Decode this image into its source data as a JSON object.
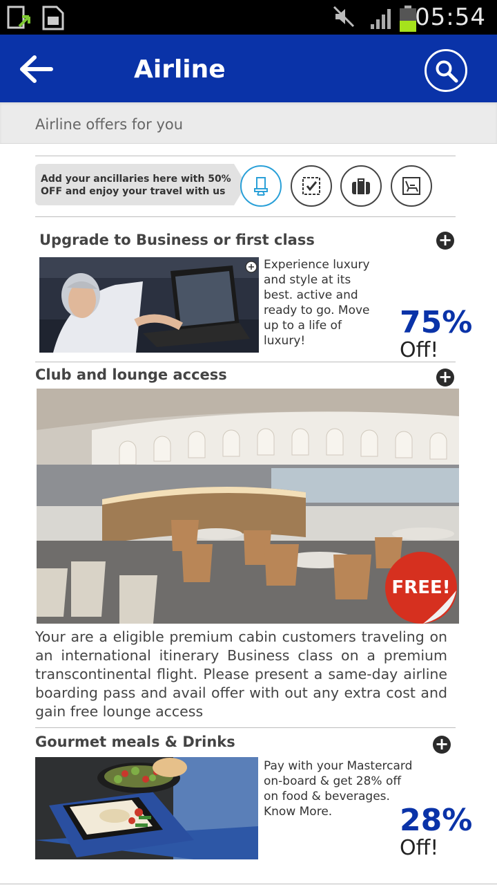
{
  "status_bar": {
    "time": "05:54",
    "icons": [
      "download-icon",
      "sim-card-icon",
      "mute-icon",
      "signal-icon",
      "battery-icon"
    ]
  },
  "app_bar": {
    "title": "Airline",
    "back_icon": "back-arrow-icon",
    "search_icon": "search-icon",
    "color": "#0a33a8"
  },
  "subheader": {
    "text": "Airline offers for you"
  },
  "promo": {
    "text": "Add your ancillaries here with 50% OFF and enjoy your travel with us",
    "ancillaries": [
      {
        "icon": "seat-icon",
        "active": true
      },
      {
        "icon": "checklist-icon",
        "active": false
      },
      {
        "icon": "baggage-icon",
        "active": false
      },
      {
        "icon": "lounge-chair-icon",
        "active": false
      }
    ]
  },
  "sections": {
    "upgrade": {
      "title": "Upgrade to Business or first class",
      "description": "Experience luxury and style at its best. active and ready to go. Move up to a life of luxury!",
      "discount": "75%",
      "discount_suffix": "Off!"
    },
    "lounge": {
      "title": "Club and lounge access",
      "badge": "FREE!",
      "description": "Your are a  eligible premium cabin customers traveling on an international itinerary Business class on a premium transcontinental flight. Please present a same-day airline boarding pass and avail offer with out any extra cost and gain free lounge access"
    },
    "meals": {
      "title": "Gourmet meals & Drinks",
      "description": "Pay with your Mastercard on-board & get 28% off on food & beverages. Know More.",
      "discount": "28%",
      "discount_suffix": "Off!"
    }
  }
}
